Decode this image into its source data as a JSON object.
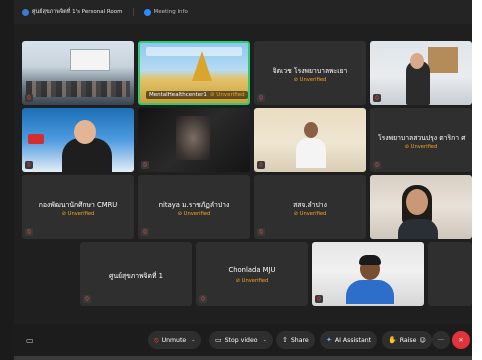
{
  "titlebar": {
    "meeting_room": "ศูนย์สุขภาพจิตที่ 1's Personal Room",
    "meeting_info": "Meeting Info"
  },
  "participants": [
    {
      "name": "",
      "status": "",
      "video": "room"
    },
    {
      "name": "MentalHealthcenter1",
      "status": "Unverified",
      "video": "temple"
    },
    {
      "name": "จิตเวช โรงพยาบาลพะเยา",
      "status": "Unverified",
      "video": "none"
    },
    {
      "name": "",
      "status": "",
      "video": "woman1"
    },
    {
      "name": "",
      "status": "",
      "video": "woman2"
    },
    {
      "name": "",
      "status": "",
      "video": "dark"
    },
    {
      "name": "",
      "status": "",
      "video": "man1"
    },
    {
      "name": "โรงพยาบาลสวนปรุง ตาริกา ศ",
      "status": "Unverified",
      "video": "none"
    },
    {
      "name": "กองพัฒนานักศึกษา CMRU",
      "status": "Unverified",
      "video": "none"
    },
    {
      "name": "nitaya ม.ราชภัฏลำปาง",
      "status": "Unverified",
      "video": "none"
    },
    {
      "name": "สสจ.ลำปาง",
      "status": "Unverified",
      "video": "none"
    },
    {
      "name": "",
      "status": "",
      "video": "woman3"
    },
    {
      "name": "ศูนย์สุขภาพจิตที่ 1",
      "status": "",
      "video": "none"
    },
    {
      "name": "Chonlada MJU",
      "status": "Unverified",
      "video": "none"
    },
    {
      "name": "",
      "status": "",
      "video": "man2"
    }
  ],
  "toolbar": {
    "unmute": "Unmute",
    "stop_video": "Stop video",
    "share": "Share",
    "ai_assistant": "AI Assistant",
    "raise": "Raise",
    "more": "···",
    "end": "✕"
  },
  "icons": {
    "mic_muted": "mic-muted-icon",
    "unverified": "unverified-icon",
    "chat": "chat-icon"
  },
  "colors": {
    "unverified": "#f5a623",
    "active_speaker": "#2ecc71",
    "end_call": "#e0333a"
  }
}
